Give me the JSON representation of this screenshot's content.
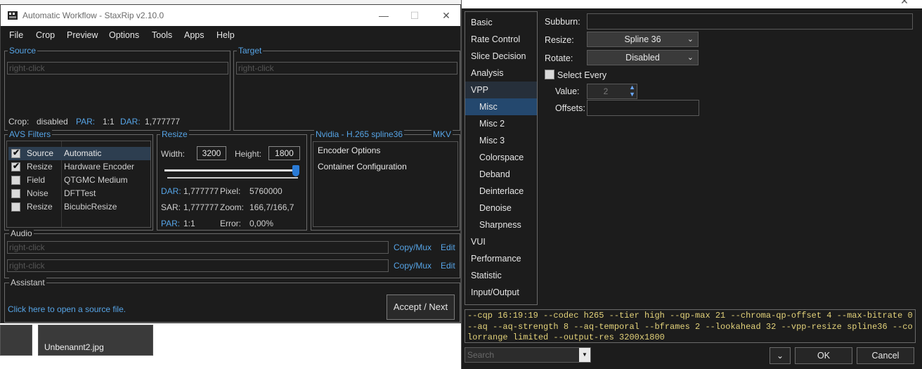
{
  "main_window": {
    "title": "Automatic Workflow - StaxRip v2.10.0",
    "menu": [
      "File",
      "Crop",
      "Preview",
      "Options",
      "Tools",
      "Apps",
      "Help"
    ],
    "source": {
      "legend": "Source",
      "placeholder": "right-click",
      "crop_label": "Crop:",
      "crop_value": "disabled",
      "par_label": "PAR:",
      "par_value": "1:1",
      "dar_label": "DAR:",
      "dar_value": "1,777777"
    },
    "target": {
      "legend": "Target",
      "placeholder": "right-click"
    },
    "avs_filters": {
      "legend": "AVS Filters",
      "rows": [
        {
          "checked": true,
          "category": "Source",
          "name": "Automatic",
          "selected": true
        },
        {
          "checked": true,
          "category": "Resize",
          "name": "Hardware Encoder",
          "selected": false
        },
        {
          "checked": false,
          "category": "Field",
          "name": "QTGMC Medium",
          "selected": false
        },
        {
          "checked": false,
          "category": "Noise",
          "name": "DFTTest",
          "selected": false
        },
        {
          "checked": false,
          "category": "Resize",
          "name": "BicubicResize",
          "selected": false
        }
      ]
    },
    "resize": {
      "legend": "Resize",
      "width_label": "Width:",
      "width_value": "3200",
      "height_label": "Height:",
      "height_value": "1800",
      "slider_level": 1.0,
      "dar_label": "DAR:",
      "dar_value": "1,777777",
      "pixel_label": "Pixel:",
      "pixel_value": "5760000",
      "sar_label": "SAR:",
      "sar_value": "1,777777",
      "zoom_label": "Zoom:",
      "zoom_value": "166,7/166,7",
      "par_label": "PAR:",
      "par_value": "1:1",
      "error_label": "Error:",
      "error_value": "0,00%"
    },
    "encoder": {
      "legend": "Nvidia - H.265 spline36",
      "container": "MKV",
      "items": [
        "Encoder Options",
        "Container Configuration"
      ]
    },
    "audio": {
      "legend": "Audio",
      "tracks": [
        {
          "placeholder": "right-click",
          "action1": "Copy/Mux",
          "action2": "Edit"
        },
        {
          "placeholder": "right-click",
          "action1": "Copy/Mux",
          "action2": "Edit"
        }
      ]
    },
    "assistant": {
      "legend": "Assistant",
      "message": "Click here to open a source file.",
      "button": "Accept / Next"
    }
  },
  "desktop": {
    "thumbnail_caption": "Unbenannt2.jpg"
  },
  "options_window": {
    "nav": [
      {
        "label": "Basic",
        "level": 0,
        "state": "normal"
      },
      {
        "label": "Rate Control",
        "level": 0,
        "state": "normal"
      },
      {
        "label": "Slice Decision",
        "level": 0,
        "state": "normal"
      },
      {
        "label": "Analysis",
        "level": 0,
        "state": "normal"
      },
      {
        "label": "VPP",
        "level": 0,
        "state": "expanded"
      },
      {
        "label": "Misc",
        "level": 1,
        "state": "active"
      },
      {
        "label": "Misc 2",
        "level": 1,
        "state": "normal"
      },
      {
        "label": "Misc 3",
        "level": 1,
        "state": "normal"
      },
      {
        "label": "Colorspace",
        "level": 1,
        "state": "normal"
      },
      {
        "label": "Deband",
        "level": 1,
        "state": "normal"
      },
      {
        "label": "Deinterlace",
        "level": 1,
        "state": "normal"
      },
      {
        "label": "Denoise",
        "level": 1,
        "state": "normal"
      },
      {
        "label": "Sharpness",
        "level": 1,
        "state": "normal"
      },
      {
        "label": "VUI",
        "level": 0,
        "state": "normal"
      },
      {
        "label": "Performance",
        "level": 0,
        "state": "normal"
      },
      {
        "label": "Statistic",
        "level": 0,
        "state": "normal"
      },
      {
        "label": "Input/Output",
        "level": 0,
        "state": "normal"
      }
    ],
    "fields": {
      "subburn_label": "Subburn:",
      "subburn_value": "",
      "resize_label": "Resize:",
      "resize_value": "Spline 36",
      "rotate_label": "Rotate:",
      "rotate_value": "Disabled",
      "select_every_label": "Select Every",
      "select_every_checked": false,
      "value_label": "Value:",
      "value_value": "2",
      "offsets_label": "Offsets:",
      "offsets_value": ""
    },
    "command_line": "--cqp 16:19:19 --codec h265 --tier high --qp-max 21 --chroma-qp-offset 4 --max-bitrate 0 --aq --aq-strength 8 --aq-temporal --bframes 2 --lookahead 32 --vpp-resize spline36 --colorrange limited --output-res 3200x1800",
    "search_placeholder": "Search",
    "ok_button": "OK",
    "cancel_button": "Cancel"
  },
  "colors": {
    "window_bg": "#1c1c1c",
    "accent_blue": "#56a4e6",
    "selection_blue": "#24486e",
    "cmdline_text": "#e3d27a"
  }
}
